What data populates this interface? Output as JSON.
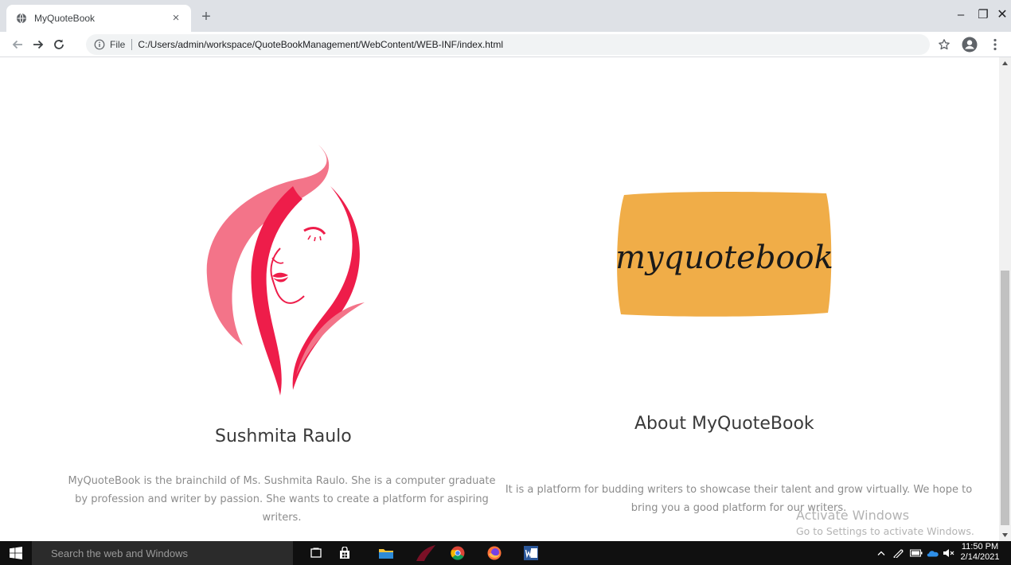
{
  "browser": {
    "tab_title": "MyQuoteBook",
    "tab_close": "×",
    "new_tab": "+",
    "window": {
      "minimize": "–",
      "maximize": "❐",
      "close": "✕"
    },
    "address": {
      "scheme": "File",
      "url": "C:/Users/admin/workspace/QuoteBookManagement/WebContent/WEB-INF/index.html"
    }
  },
  "page": {
    "left": {
      "heading": "Sushmita Raulo",
      "text": "MyQuoteBook is the brainchild of Ms. Sushmita Raulo. She is a computer graduate by profession and writer by passion. She wants to create a platform for aspiring writers."
    },
    "right": {
      "logo_text": "myquotebook",
      "heading": "About MyQuoteBook",
      "text": "It is a platform for budding writers to showcase their talent and grow virtually. We hope to bring you a good platform for our writers."
    },
    "watermark": {
      "title": "Activate Windows",
      "subtitle": "Go to Settings to activate Windows."
    }
  },
  "taskbar": {
    "search_placeholder": "Search the web and Windows",
    "clock": {
      "time": "11:50 PM",
      "date": "2/14/2021"
    }
  },
  "colors": {
    "pink_primary": "#ee1d4a",
    "pink_light": "#f37489",
    "logo_background": "#f0ad48",
    "heading": "#3a3a3a",
    "body_text": "#8c8c8c"
  }
}
